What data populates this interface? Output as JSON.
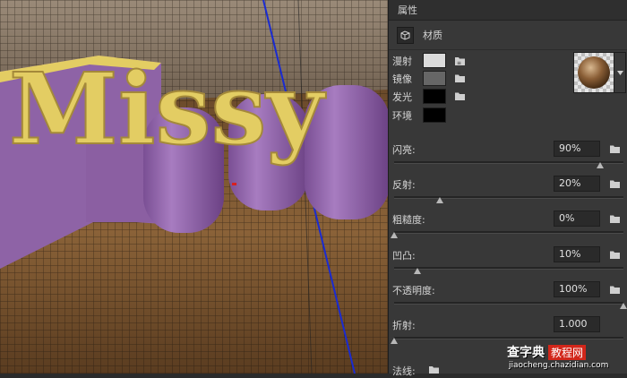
{
  "panel": {
    "title": "属性",
    "material_tab": "材质"
  },
  "colors": [
    {
      "label": "漫射",
      "swatch": "#dcdcdc"
    },
    {
      "label": "镜像",
      "swatch": "#666666"
    },
    {
      "label": "发光",
      "swatch": "#000000"
    },
    {
      "label": "环境",
      "swatch": "#000000"
    }
  ],
  "sliders": [
    {
      "label": "闪亮:",
      "value": "90%",
      "level": 0.9
    },
    {
      "label": "反射:",
      "value": "20%",
      "level": 0.2
    },
    {
      "label": "粗糙度:",
      "value": "0%",
      "level": 0.0
    },
    {
      "label": "凹凸:",
      "value": "10%",
      "level": 0.1
    },
    {
      "label": "不透明度:",
      "value": "100%",
      "level": 1.0
    },
    {
      "label": "折射:",
      "value": "1.000",
      "level": 0.0
    }
  ],
  "footer": {
    "normal_label": "法线:"
  },
  "scene": {
    "text": "Missy"
  },
  "watermark": {
    "brand": "查字典",
    "sub": "教程网",
    "url": "jiaocheng.chazidian.com"
  }
}
